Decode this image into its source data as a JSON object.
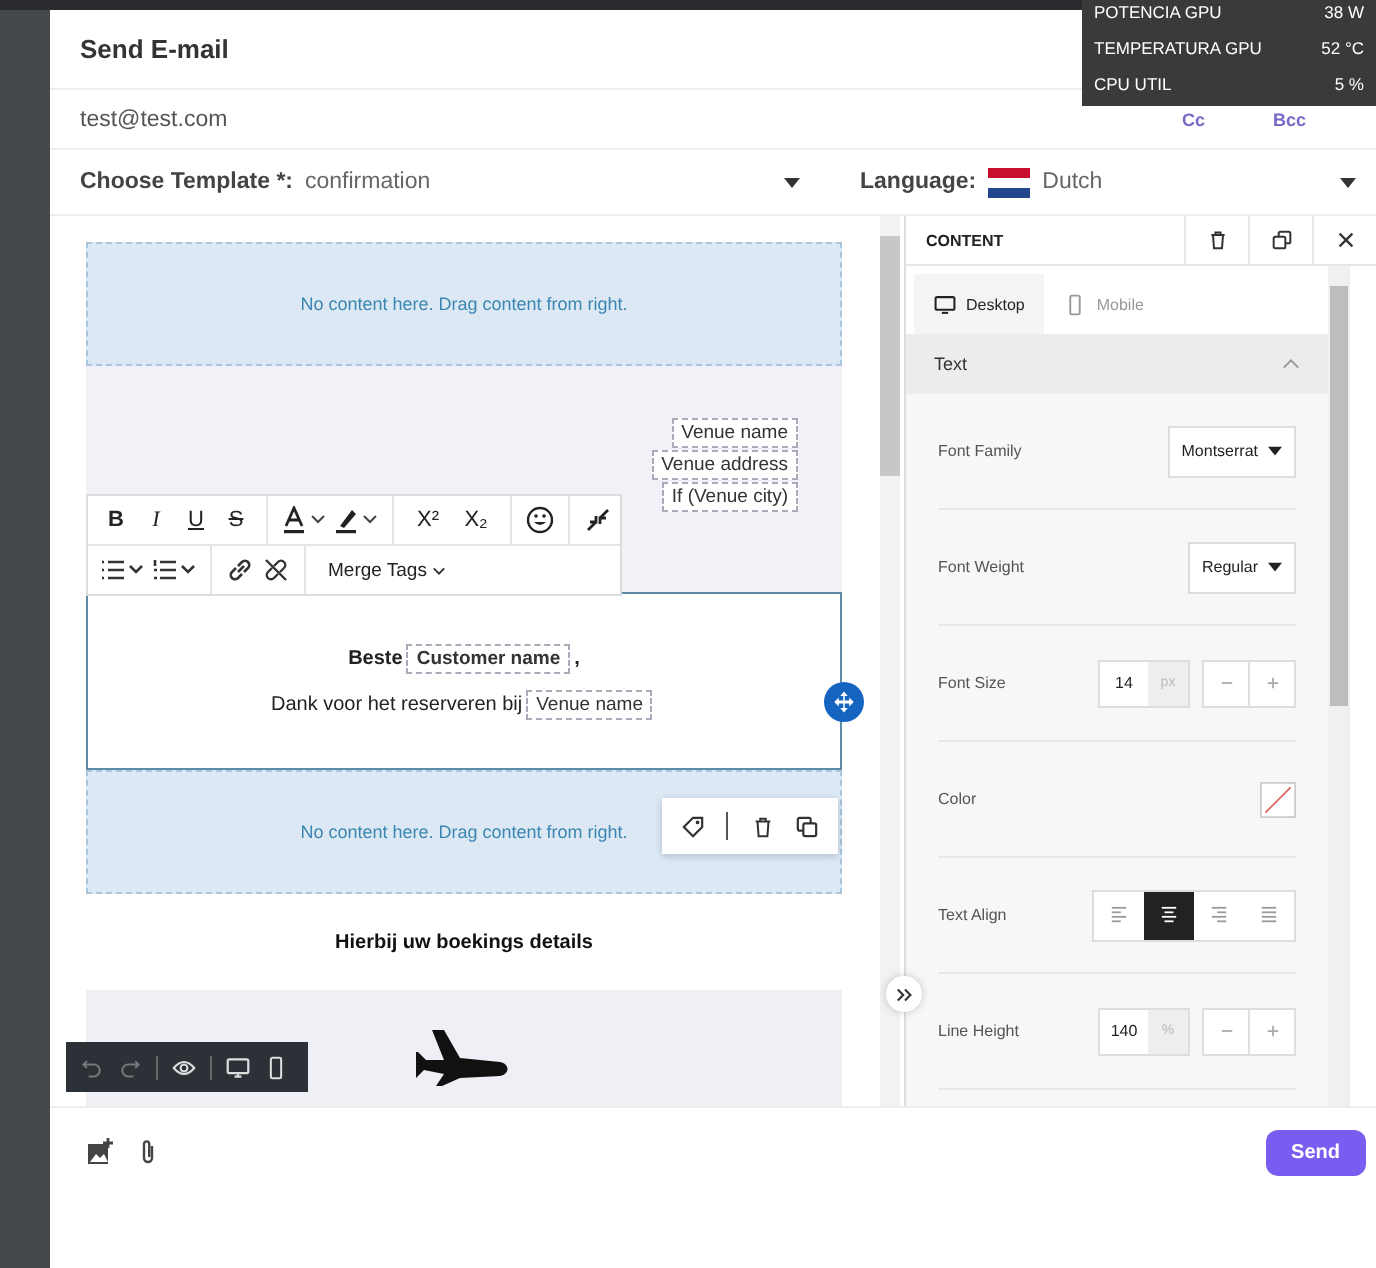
{
  "window": {
    "title": "Send E-mail"
  },
  "system_overlay": [
    {
      "label": "POTENCIA GPU",
      "value": "38 W"
    },
    {
      "label": "TEMPERATURA GPU",
      "value": "52 °C"
    },
    {
      "label": "CPU UTIL",
      "value": "5 %"
    }
  ],
  "recipient": {
    "value": "test@test.com",
    "links": [
      "Cc",
      "Bcc"
    ]
  },
  "template": {
    "label": "Choose Template *:",
    "value": "confirmation"
  },
  "language": {
    "label": "Language:",
    "value": "Dutch"
  },
  "editor": {
    "dropzone_top": "No content here. Drag content from right.",
    "venue_tags": [
      "Venue name",
      "Venue address",
      "If (Venue city)"
    ],
    "format_buttons": [
      "B",
      "I",
      "U",
      "S"
    ],
    "script_buttons": [
      "X²",
      "X₂"
    ],
    "merge_tags": "Merge Tags",
    "text_block": {
      "greeting": "Beste",
      "greeting_tag": "Customer name",
      "greeting_end": ",",
      "line": "Dank voor het reserveren bij",
      "line_tag": "Venue name"
    },
    "dropzone_bottom": "No content here. Drag content from right.",
    "heading": "Hierbij uw boekings details"
  },
  "panel": {
    "title": "CONTENT",
    "tabs": [
      {
        "label": "Desktop",
        "selected": true
      },
      {
        "label": "Mobile",
        "selected": false
      }
    ],
    "section": {
      "title": "Text",
      "expanded": true
    },
    "rows": [
      {
        "kind": "select",
        "label": "Font Family",
        "value": "Montserrat"
      },
      {
        "kind": "select",
        "label": "Font Weight",
        "value": "Regular"
      },
      {
        "kind": "number",
        "label": "Font Size",
        "value": "14",
        "unit": "px"
      },
      {
        "kind": "color",
        "label": "Color"
      },
      {
        "kind": "align",
        "label": "Text Align",
        "options": [
          {
            "selected": false
          },
          {
            "selected": true
          },
          {
            "selected": false
          },
          {
            "selected": false
          }
        ]
      },
      {
        "kind": "number",
        "label": "Line Height",
        "value": "140",
        "unit": "%"
      }
    ]
  },
  "footer": {
    "send": "Send"
  }
}
